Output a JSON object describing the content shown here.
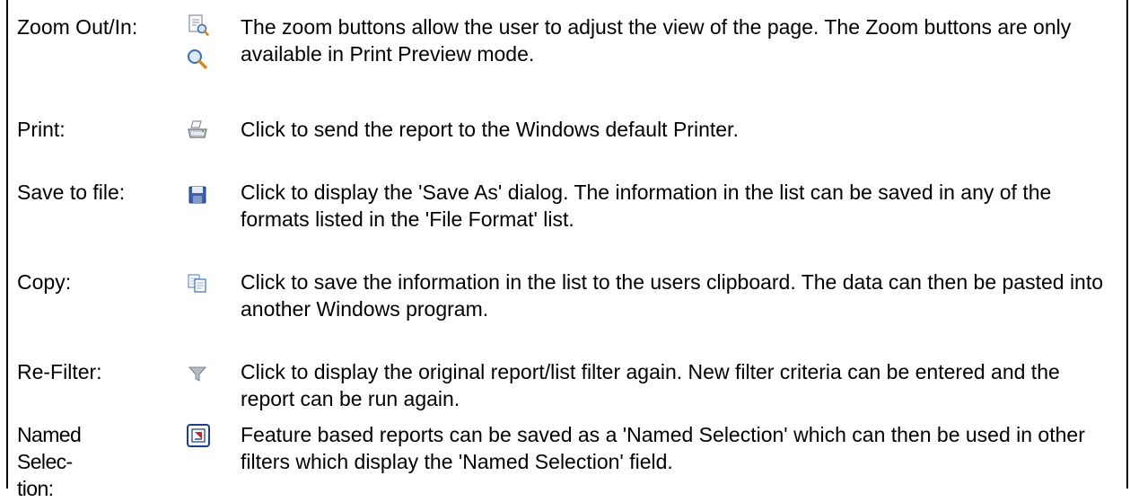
{
  "rows": [
    {
      "label": "Zoom Out/In:",
      "icons": [
        "zoom-out-icon",
        "zoom-in-icon"
      ],
      "description": "The zoom buttons allow the user to adjust the view of the page. The Zoom buttons are only available in Print Preview mode."
    },
    {
      "label": "Print:",
      "icons": [
        "printer-icon"
      ],
      "description": "Click to send the report to the Windows default Printer."
    },
    {
      "label": "Save to file:",
      "icons": [
        "floppy-disk-icon"
      ],
      "description": "Click to display the 'Save As' dialog. The information in the list can be saved in any of the formats listed in the 'File Format' list."
    },
    {
      "label": "Copy:",
      "icons": [
        "copy-icon"
      ],
      "description": "Click to save the information in the list to the users clipboard. The data can then be pasted into another Windows program."
    },
    {
      "label": "Re-Filter:",
      "icons": [
        "filter-icon"
      ],
      "description": "Click to display the original report/list filter again. New filter criteria can be entered and the report can be run again."
    },
    {
      "label": "Named Selec- tion:",
      "icons": [
        "named-selection-icon"
      ],
      "description": "Feature based reports can be saved as a 'Named Selection' which can then be used in other filters which display the 'Named Selection' field."
    }
  ],
  "colors": {
    "border": "#000000",
    "text": "#000000",
    "icon_blue": "#3b6db3",
    "icon_grey": "#8a8f99",
    "icon_red": "#c0282d"
  }
}
